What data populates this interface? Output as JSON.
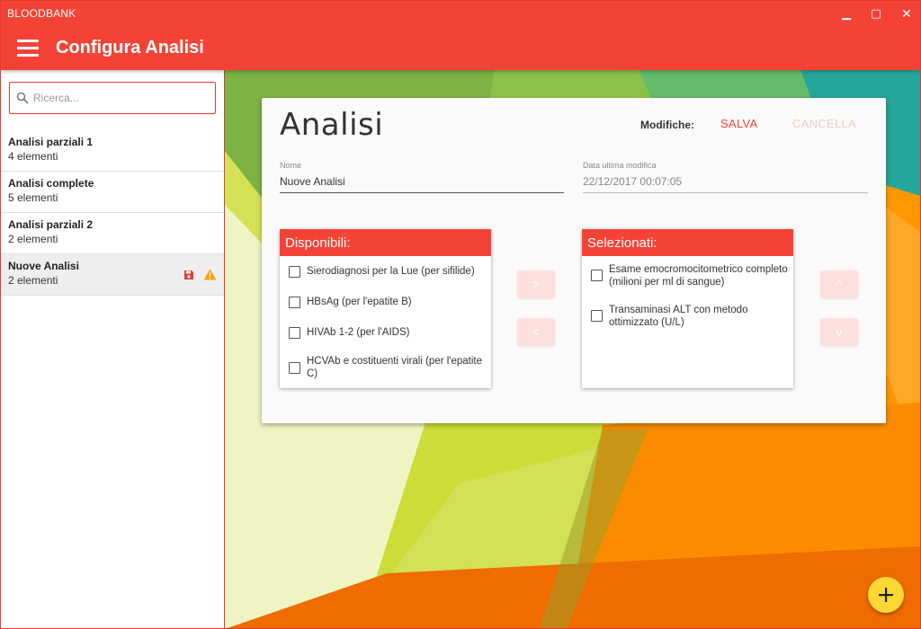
{
  "window": {
    "title": "BLOODBANK",
    "controls": {
      "minimize": "▁",
      "maximize": "▢",
      "close": "✕"
    }
  },
  "appbar": {
    "title": "Configura Analisi",
    "menu_icon": "hamburger-menu-icon"
  },
  "sidebar": {
    "search": {
      "placeholder": "Ricerca...",
      "value": "",
      "icon": "search-icon"
    },
    "items": [
      {
        "title": "Analisi parziali 1",
        "subtitle": "4 elementi",
        "selected": false
      },
      {
        "title": "Analisi complete",
        "subtitle": "5 elementi",
        "selected": false
      },
      {
        "title": "Analisi parziali 2",
        "subtitle": "2 elementi",
        "selected": false
      },
      {
        "title": "Nuove Analisi",
        "subtitle": "2 elementi",
        "selected": true,
        "icons": [
          "save-icon",
          "warning-icon"
        ]
      }
    ]
  },
  "editor": {
    "title": "Analisi",
    "changes_label": "Modifiche:",
    "save_label": "SALVA",
    "cancel_label": "CANCELLA",
    "name_field": {
      "label": "Nome",
      "value": "Nuove Analisi"
    },
    "date_field": {
      "label": "Data ultima modifica",
      "value": "22/12/2017 00:07:05"
    },
    "available": {
      "header": "Disponibili:",
      "items": [
        "Sierodiagnosi per la Lue (per sifilide)",
        "HBsAg (per l'epatite B)",
        "HIVAb 1-2 (per l'AIDS)",
        "HCVAb e costituenti virali (per l'epatite C)"
      ]
    },
    "selected": {
      "header": "Selezionati:",
      "items": [
        "Esame emocromocitometrico completo (milioni per ml di sangue)",
        "Transaminasi ALT con metodo ottimizzato (U/L)"
      ]
    },
    "buttons": {
      "add": ">",
      "remove": "<",
      "up": "^",
      "down": "v"
    }
  },
  "fab": {
    "icon": "plus-icon"
  },
  "colors": {
    "primary": "#f44336",
    "accent": "#fdd835",
    "warning": "#ffa000",
    "disabled_text": "#f8c8c4"
  }
}
